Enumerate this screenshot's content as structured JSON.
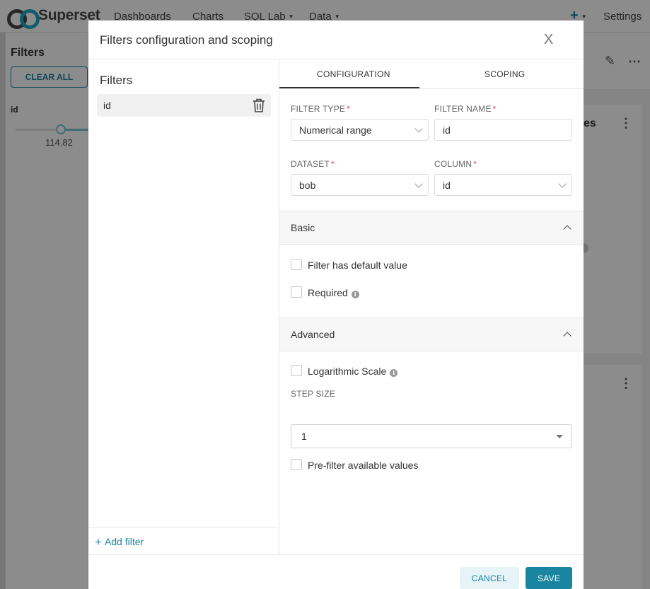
{
  "app": {
    "brand": "Superset",
    "nav": [
      {
        "label": "Dashboards"
      },
      {
        "label": "Charts"
      },
      {
        "label": "SQL Lab"
      },
      {
        "label": "Data"
      },
      {
        "label": "Settings"
      }
    ]
  },
  "filter_panel": {
    "title": "Filters",
    "clear_all": "CLEAR ALL",
    "filter_label": "id",
    "slider_value": "114.82"
  },
  "background": {
    "card_title_fragment": "es"
  },
  "modal": {
    "title": "Filters configuration and scoping",
    "close": "X",
    "sidebar": {
      "title": "Filters",
      "items": [
        {
          "label": "id"
        }
      ],
      "add_filter": "Add filter"
    },
    "tabs": {
      "configuration": "CONFIGURATION",
      "scoping": "SCOPING",
      "active": "CONFIGURATION"
    },
    "form": {
      "filter_type": {
        "label": "FILTER TYPE",
        "value": "Numerical range"
      },
      "filter_name": {
        "label": "FILTER NAME",
        "value": "id"
      },
      "dataset": {
        "label": "DATASET",
        "value": "bob"
      },
      "column": {
        "label": "COLUMN",
        "value": "id"
      }
    },
    "basic": {
      "title": "Basic",
      "default_value": "Filter has default value",
      "required": "Required"
    },
    "advanced": {
      "title": "Advanced",
      "log_scale": "Logarithmic Scale",
      "step_size_label": "STEP SIZE",
      "step_size_value": "1",
      "pre_filter": "Pre-filter available values"
    },
    "footer": {
      "cancel": "CANCEL",
      "save": "SAVE"
    }
  },
  "colors": {
    "primary": "#1a85a0",
    "required": "#e04355"
  }
}
